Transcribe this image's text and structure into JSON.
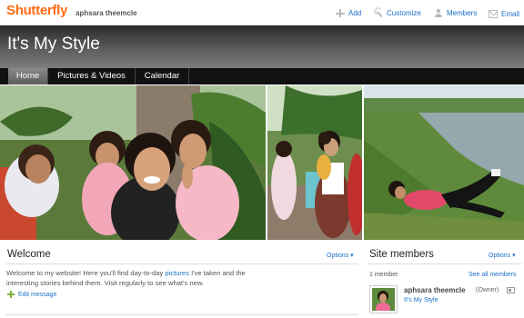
{
  "brand": {
    "logo": "Shutterfly",
    "accent": "#ff6a13",
    "link": "#1a6fc7"
  },
  "topbar": {
    "username": "aphsara theemcle",
    "links": [
      {
        "label": "Add",
        "icon": "plus-icon"
      },
      {
        "label": "Customize",
        "icon": "wrench-icon"
      },
      {
        "label": "Members",
        "icon": "person-icon"
      },
      {
        "label": "Email",
        "icon": "mail-icon"
      }
    ]
  },
  "header": {
    "title": "It's My Style"
  },
  "nav": {
    "tabs": [
      "Home",
      "Pictures & Videos",
      "Calendar"
    ],
    "active": "Home"
  },
  "welcome": {
    "title": "Welcome",
    "options": "Options ▾",
    "body_before": "Welcome to my website! Here you'll find day-to-day ",
    "body_link": "pictures",
    "body_after": " I've taken and the interesting stories behind them. Visit regularly to see what's new.",
    "edit": "Edit message"
  },
  "members": {
    "title": "Site members",
    "options": "Options ▾",
    "count": "1 member",
    "see_all": "See all members",
    "list": [
      {
        "name": "aphsara theemcle",
        "role": "(Owner)",
        "site": "It's My Style"
      }
    ]
  }
}
